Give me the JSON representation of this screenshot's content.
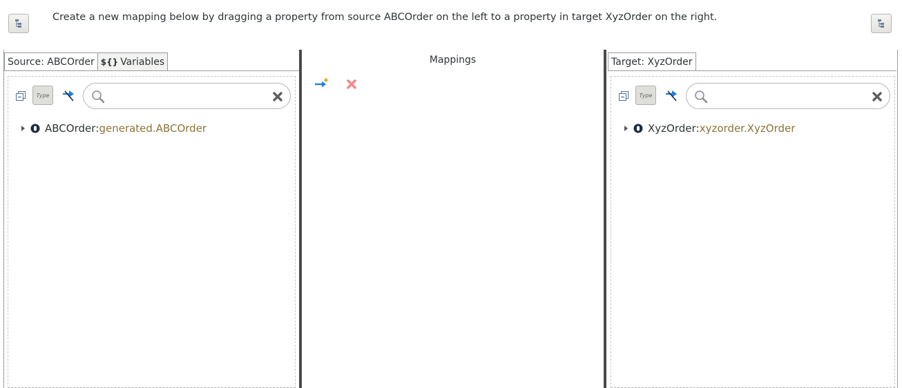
{
  "banner": {
    "message": "Create a new mapping below by dragging a property from source ABCOrder on the left to a property in target XyzOrder  on the right."
  },
  "source": {
    "tabs": [
      {
        "label": "Source: ABCOrder",
        "active": true
      },
      {
        "label": "Variables",
        "glyph": "${}",
        "active": false
      }
    ],
    "type_button_label": "Type",
    "search": {
      "value": "",
      "placeholder": ""
    },
    "tree": [
      {
        "name": "ABCOrder",
        "separator": ": ",
        "type": "generated.ABCOrder"
      }
    ]
  },
  "mappings": {
    "title": "Mappings"
  },
  "target": {
    "tabs": [
      {
        "label": "Target: XyzOrder",
        "active": true
      }
    ],
    "type_button_label": "Type",
    "search": {
      "value": "",
      "placeholder": ""
    },
    "tree": [
      {
        "name": "XyzOrder",
        "separator": ": ",
        "type": "xyzorder.XyzOrder"
      }
    ]
  },
  "colors": {
    "type_text": "#8a7336",
    "link_blue": "#1f7fe0",
    "delete_red": "#e05252",
    "panel_divider": "#4a4a4a"
  },
  "icons": {
    "toolbar_left": "tree-layout-icon",
    "toolbar_right": "tree-layout-icon",
    "collapse": "collapse-all-icon",
    "link": "link-arrow-icon",
    "search": "magnifier-icon",
    "clear": "clear-x-icon",
    "add_mapping": "add-mapping-icon",
    "delete_mapping": "delete-mapping-icon"
  }
}
